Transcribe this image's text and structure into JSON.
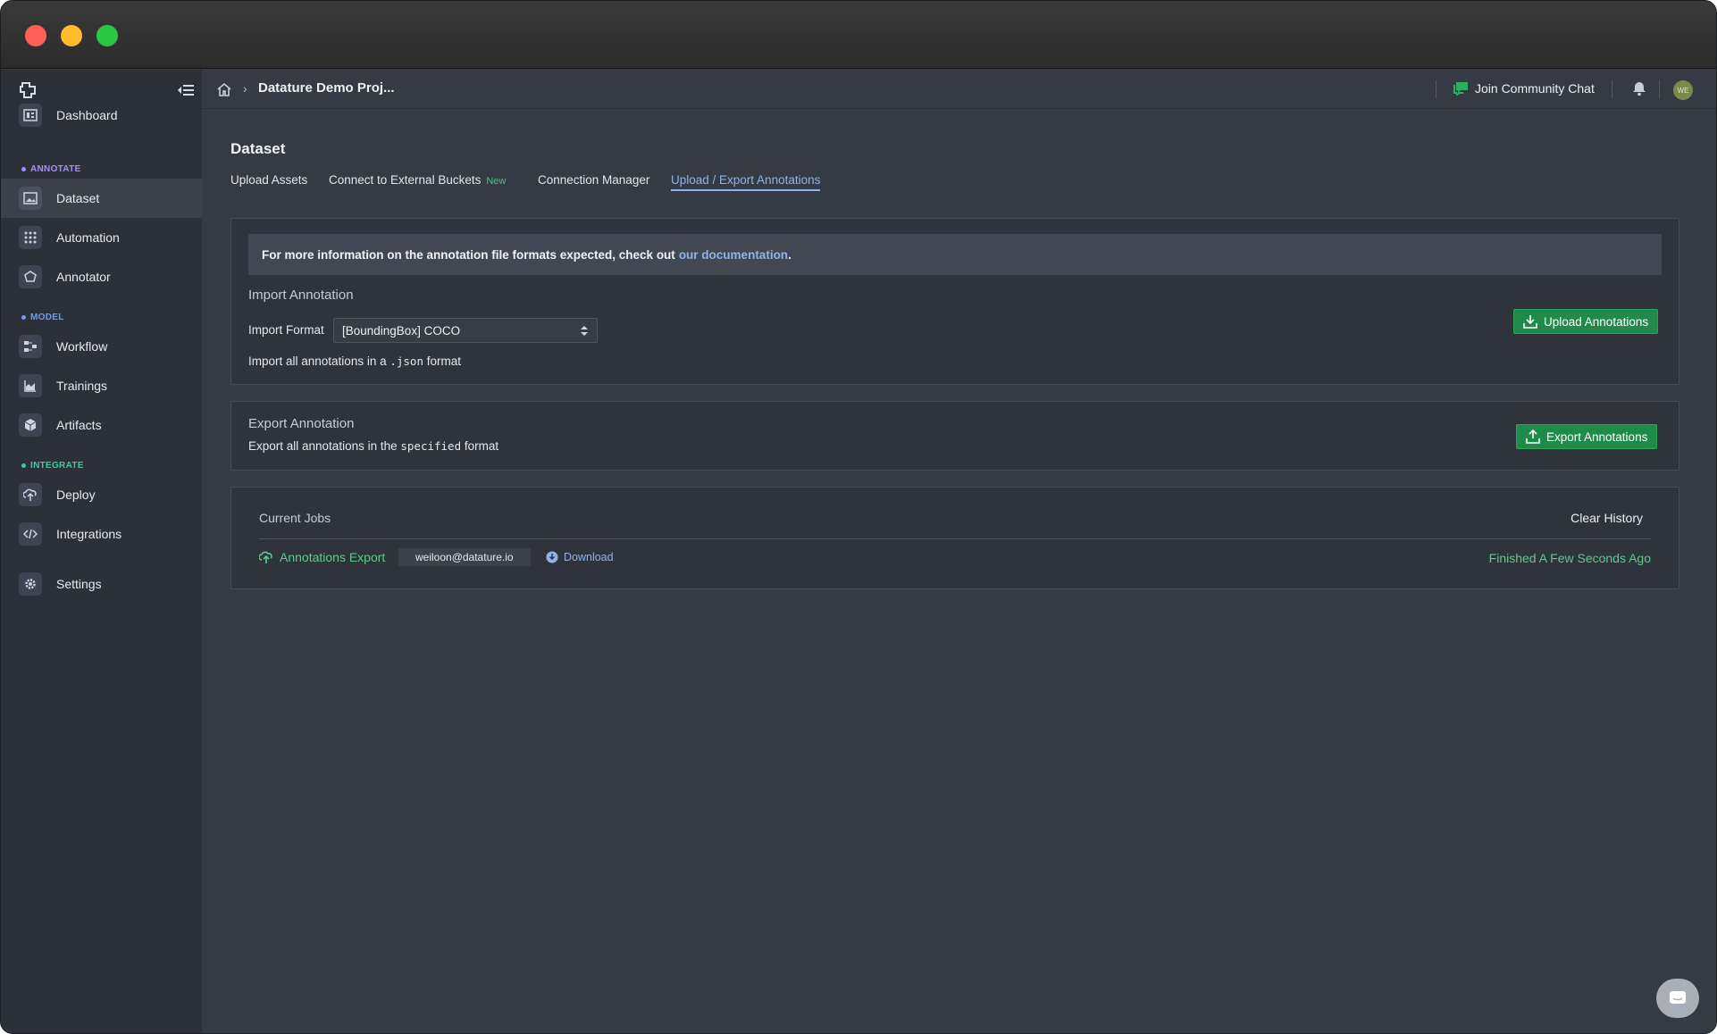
{
  "sidebar": {
    "items": [
      {
        "label": "Dashboard"
      },
      {
        "label": "Dataset"
      },
      {
        "label": "Automation"
      },
      {
        "label": "Annotator"
      },
      {
        "label": "Workflow"
      },
      {
        "label": "Trainings"
      },
      {
        "label": "Artifacts"
      },
      {
        "label": "Deploy"
      },
      {
        "label": "Integrations"
      },
      {
        "label": "Settings"
      }
    ],
    "sections": {
      "annotate": "ANNOTATE",
      "model": "MODEL",
      "integrate": "INTEGRATE"
    },
    "section_colors": {
      "annotate": "#a78bfa",
      "model": "#6b9cf2",
      "integrate": "#3ec9a4"
    },
    "active_item": "Dataset"
  },
  "topbar": {
    "breadcrumb_title": "Datature Demo Proj...",
    "community_label": "Join Community Chat",
    "avatar_initials": "WE"
  },
  "page": {
    "title": "Dataset",
    "tabs": [
      {
        "label": "Upload Assets"
      },
      {
        "label": "Connect to External Buckets",
        "badge": "New"
      },
      {
        "label": "Connection Manager"
      },
      {
        "label": "Upload / Export Annotations"
      }
    ],
    "active_tab": "Upload / Export Annotations"
  },
  "import_panel": {
    "info_text": "For more information on the annotation file formats expected, check out",
    "info_link": "our documentation",
    "info_end": ".",
    "section_title": "Import Annotation",
    "format_label": "Import Format",
    "format_value": "[BoundingBox] COCO",
    "hint_prefix": "Import all annotations in a",
    "hint_code": ".json",
    "hint_suffix": "format",
    "upload_button": "Upload Annotations"
  },
  "export_panel": {
    "section_title": "Export Annotation",
    "hint_prefix": "Export all annotations in the",
    "hint_code": "specified",
    "hint_suffix": "format",
    "export_button": "Export Annotations"
  },
  "jobs_panel": {
    "title": "Current Jobs",
    "clear_label": "Clear History",
    "jobs": [
      {
        "name": "Annotations Export",
        "user": "weiloon@datature.io",
        "action": "Download",
        "status": "Finished A Few Seconds Ago"
      }
    ]
  },
  "colors": {
    "accent_blue": "#8fb3ea",
    "success_green": "#5fc98a",
    "button_green": "#208a4a"
  }
}
